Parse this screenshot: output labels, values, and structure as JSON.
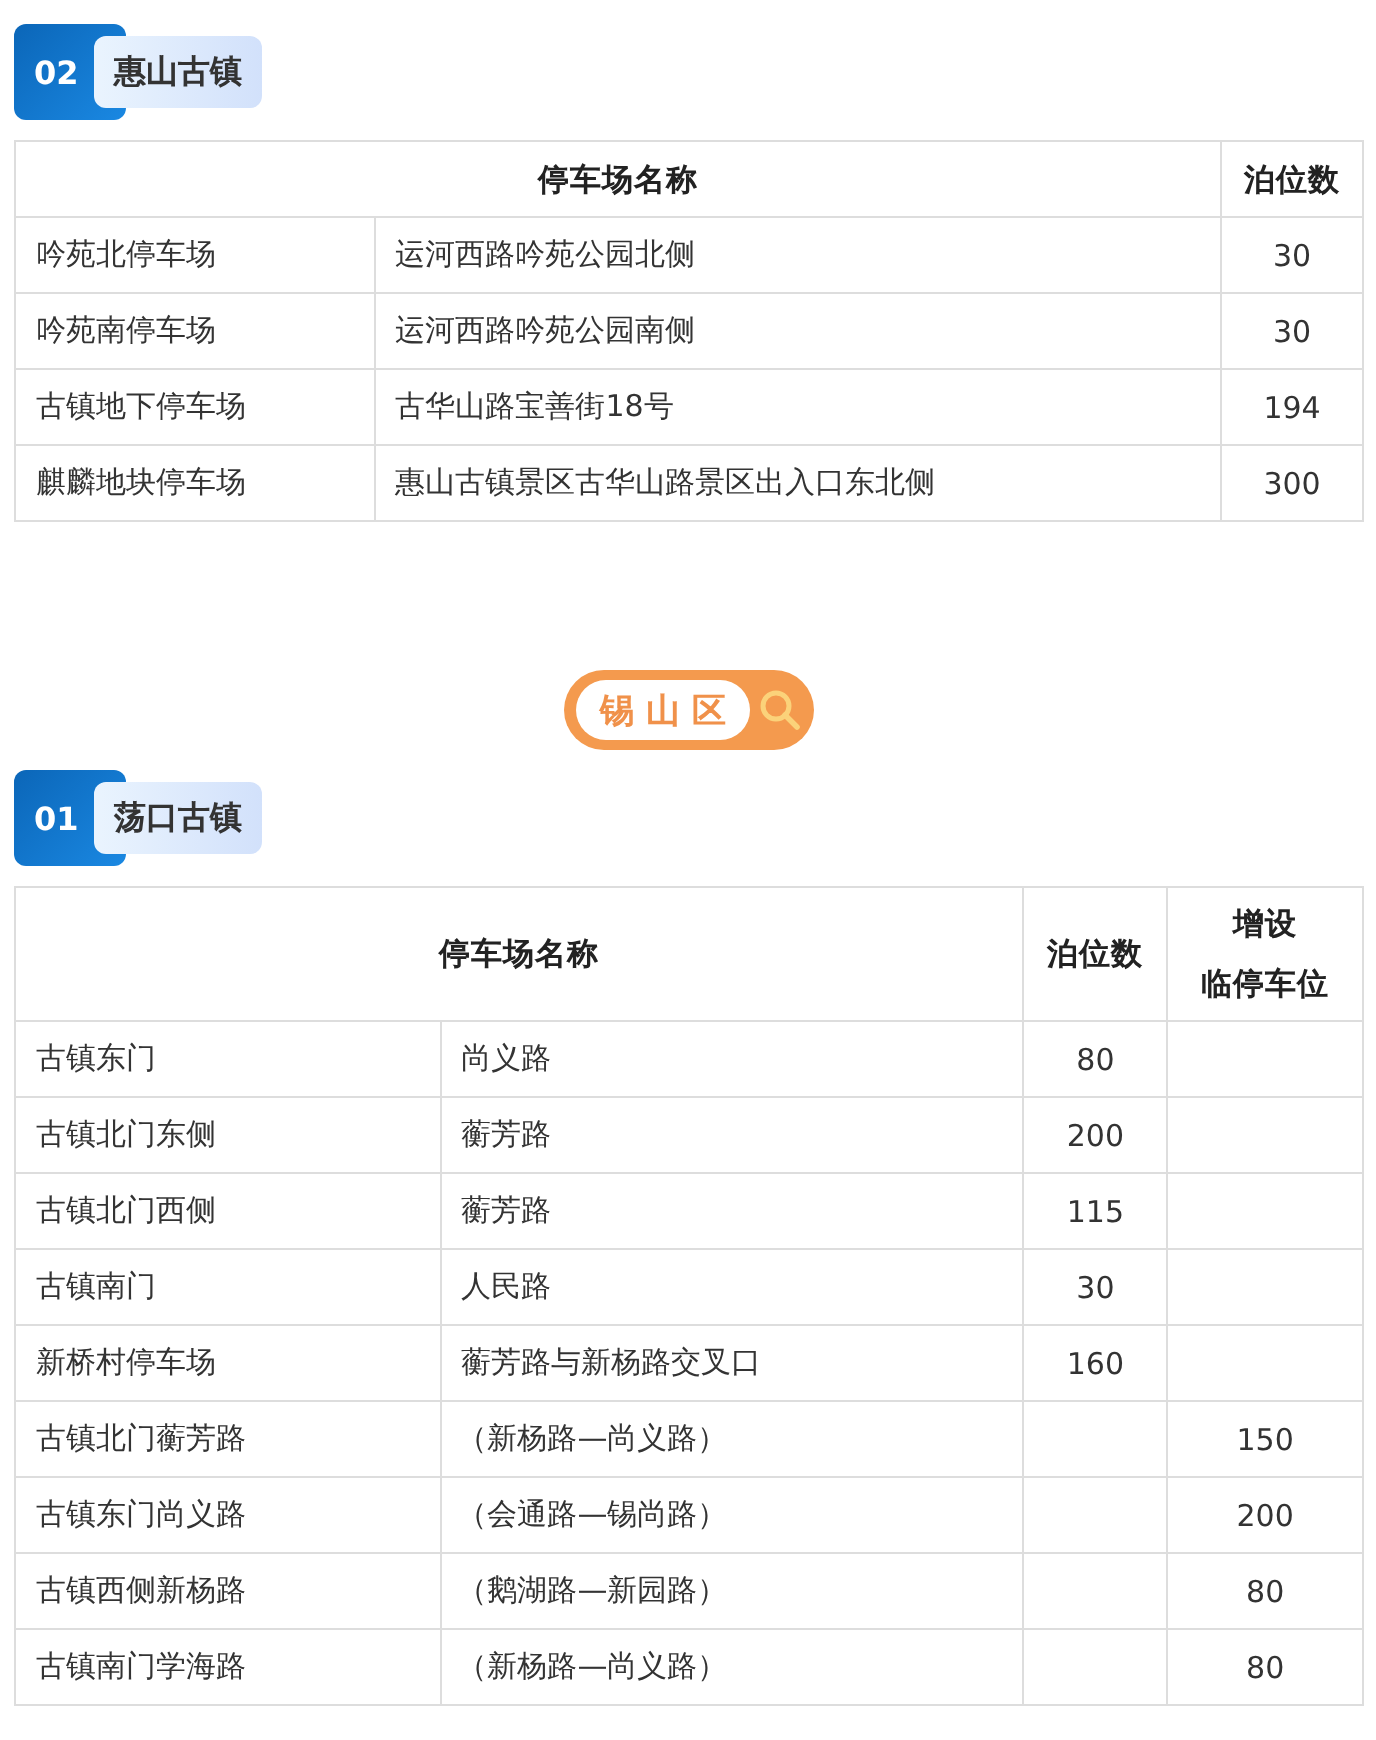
{
  "blocks": [
    {
      "kind": "section",
      "number": "02",
      "title": "惠山古镇",
      "table": {
        "header": [
          [
            "停车场名称"
          ],
          [
            "泊位数"
          ]
        ],
        "rows": [
          {
            "name": "吟苑北停车场",
            "location": "运河西路吟苑公园北侧",
            "berths": "30"
          },
          {
            "name": "吟苑南停车场",
            "location": "运河西路吟苑公园南侧",
            "berths": "30"
          },
          {
            "name": "古镇地下停车场",
            "location": "古华山路宝善街18号",
            "berths": "194"
          },
          {
            "name": "麒麟地块停车场",
            "location": "惠山古镇景区古华山路景区出入口东北侧",
            "berths": "300"
          }
        ]
      }
    },
    {
      "kind": "district",
      "label": "锡 山 区"
    },
    {
      "kind": "section",
      "number": "01",
      "title": "荡口古镇",
      "table": {
        "header": [
          [
            "停车场名称"
          ],
          [
            "泊位数"
          ],
          [
            "增设",
            "临停车位"
          ]
        ],
        "rows": [
          {
            "name": "古镇东门",
            "location": "尚义路",
            "berths": "80"
          },
          {
            "name": "古镇北门东侧",
            "location": "蘅芳路",
            "berths": "200"
          },
          {
            "name": "古镇北门西侧",
            "location": "蘅芳路",
            "berths": "115"
          },
          {
            "name": "古镇南门",
            "location": "人民路",
            "berths": "30"
          },
          {
            "name": "新桥村停车场",
            "location": "蘅芳路与新杨路交叉口",
            "berths": "160"
          },
          {
            "name": "古镇北门蘅芳路",
            "location": "（新杨路—尚义路）",
            "extra": "150"
          },
          {
            "name": "古镇东门尚义路",
            "location": "（会通路—锡尚路）",
            "extra": "200"
          },
          {
            "name": "古镇西侧新杨路",
            "location": "（鹅湖路—新园路）",
            "extra": "80"
          },
          {
            "name": "古镇南门学海路",
            "location": "（新杨路—尚义路）",
            "extra": "80"
          }
        ]
      }
    }
  ]
}
